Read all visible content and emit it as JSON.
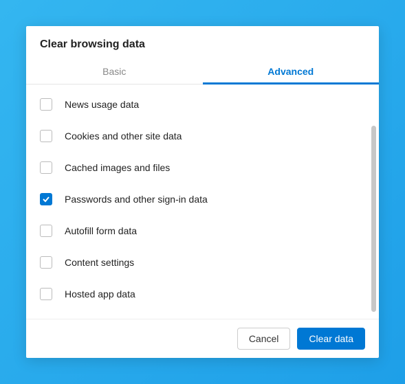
{
  "dialog": {
    "title": "Clear browsing data",
    "tabs": {
      "basic": "Basic",
      "advanced": "Advanced",
      "active": "advanced"
    },
    "items": [
      {
        "label": "News usage data",
        "checked": false
      },
      {
        "label": "Cookies and other site data",
        "checked": false
      },
      {
        "label": "Cached images and files",
        "checked": false
      },
      {
        "label": "Passwords and other sign-in data",
        "checked": true
      },
      {
        "label": "Autofill form data",
        "checked": false
      },
      {
        "label": "Content settings",
        "checked": false
      },
      {
        "label": "Hosted app data",
        "checked": false
      }
    ],
    "buttons": {
      "cancel": "Cancel",
      "clear": "Clear data"
    }
  }
}
